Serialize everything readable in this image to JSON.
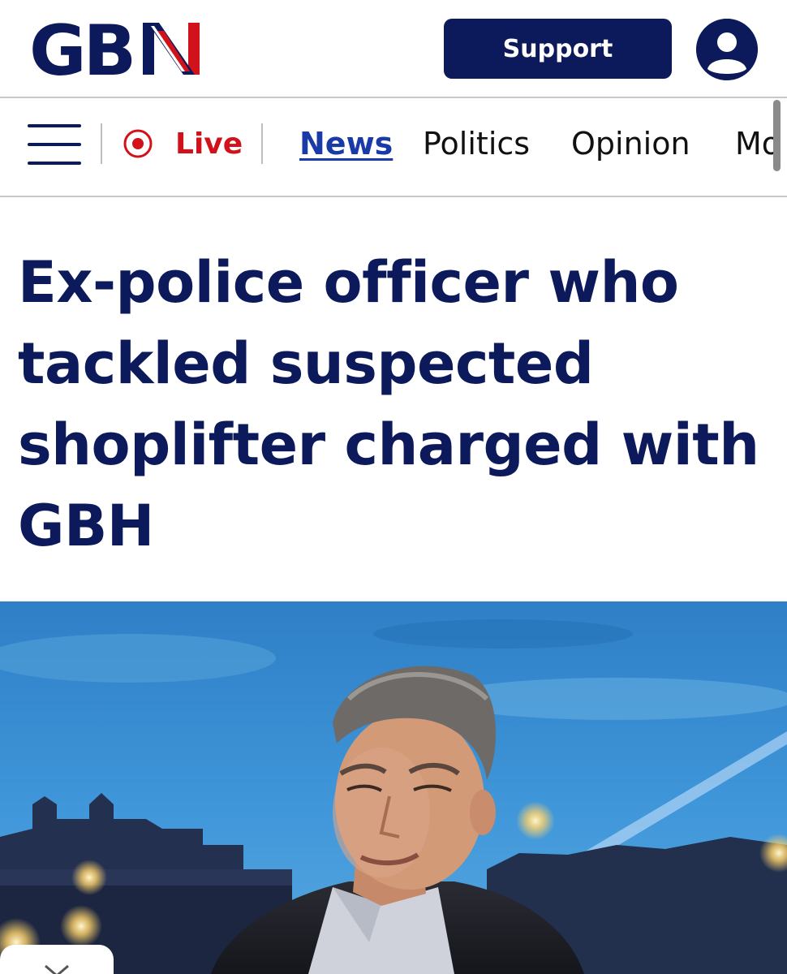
{
  "header": {
    "logo_text": "GBN",
    "support_label": "Support",
    "account_icon": "user-icon"
  },
  "nav": {
    "menu_icon": "hamburger-menu-icon",
    "live_icon": "live-record-icon",
    "live_label": "Live",
    "links": [
      {
        "label": "News",
        "active": true
      },
      {
        "label": "Politics",
        "active": false
      },
      {
        "label": "Opinion",
        "active": false
      },
      {
        "label": "Mo",
        "active": false
      }
    ]
  },
  "article": {
    "headline_lines": [
      "Ex-police officer who",
      "tackled suspected",
      "shoplifter charged with",
      "GBH"
    ]
  },
  "hero_image": {
    "subject": "man in studio in front of Westminster night backdrop"
  },
  "overlay": {
    "close_icon": "close-icon"
  },
  "colors": {
    "brand_navy": "#0c1a5b",
    "live_red": "#d1121a",
    "active_link": "#1a3aa8"
  }
}
